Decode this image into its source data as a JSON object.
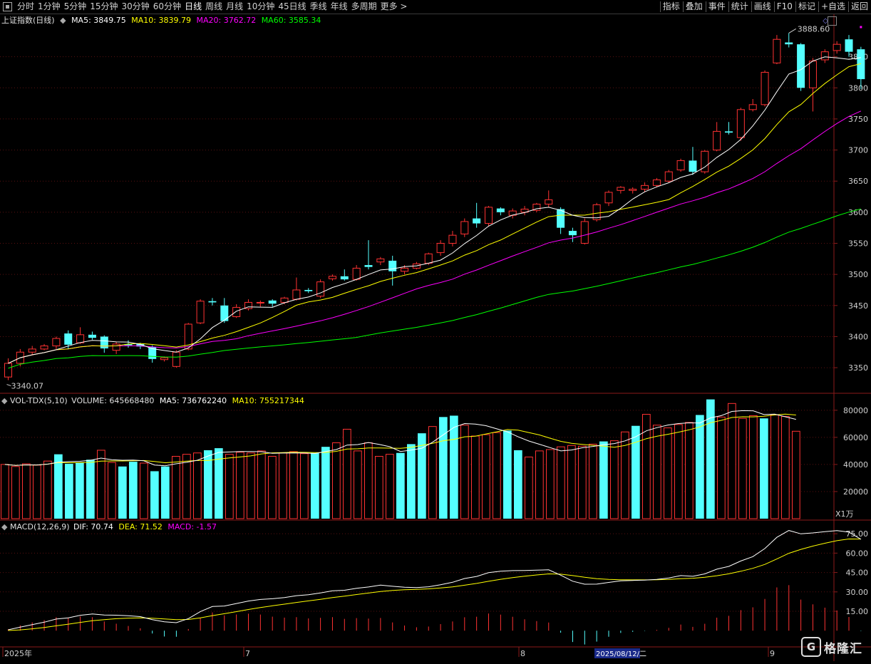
{
  "toolbar": {
    "left_icon": "stop-icon",
    "periods": [
      "分时",
      "1分钟",
      "5分钟",
      "15分钟",
      "30分钟",
      "60分钟",
      "日线",
      "周线",
      "月线",
      "10分钟",
      "45日线",
      "季线",
      "年线",
      "多周期",
      "更多 >"
    ],
    "active_period": "日线",
    "right_tools": [
      "指标",
      "叠加",
      "事件",
      "统计",
      "画线",
      "F10",
      "标记",
      "+自选",
      "返回"
    ]
  },
  "price_panel": {
    "title": "上证指数(日线)",
    "ma5_label": "MA5: 3849.75",
    "ma10_label": "MA10: 3839.79",
    "ma20_label": "MA20: 3762.72",
    "ma60_label": "MA60: 3585.34",
    "high_label": "3888.60",
    "low_label": "3340.07",
    "colors": {
      "up": "#ff3232",
      "down": "#54ffff",
      "ma5": "#ffffff",
      "ma10": "#ffff00",
      "ma20": "#ff00ff",
      "ma60": "#00ff00"
    }
  },
  "vol_panel": {
    "title": "VOL-TDX(5,10)",
    "volume_label": "VOLUME: 645668480",
    "ma5_label": "MA5: 736762240",
    "ma10_label": "MA10: 755217344",
    "unit": "X1万"
  },
  "macd_panel": {
    "title": "MACD(12,26,9)",
    "dif_label": "DIF: 70.74",
    "dea_label": "DEA: 71.52",
    "macd_label": "MACD: -1.57"
  },
  "time_axis": {
    "labels": [
      "2025年",
      "7",
      "8",
      "9"
    ],
    "cursor_date": "2025/08/12/二"
  },
  "watermark": {
    "logo": "G",
    "text": "格隆汇"
  },
  "chart_data": [
    {
      "type": "candlestick",
      "title": "上证指数(日线)",
      "ylim": [
        3310,
        3900
      ],
      "yticks": [
        3350,
        3400,
        3450,
        3500,
        3550,
        3600,
        3650,
        3700,
        3750,
        3800,
        3850
      ],
      "candles": [
        [
          3335,
          3357,
          3330,
          3365
        ],
        [
          3357,
          3375,
          3352,
          3380
        ],
        [
          3375,
          3380,
          3370,
          3385
        ],
        [
          3380,
          3385,
          3378,
          3388
        ],
        [
          3385,
          3397,
          3380,
          3400
        ],
        [
          3405,
          3387,
          3380,
          3410
        ],
        [
          3390,
          3403,
          3388,
          3415
        ],
        [
          3403,
          3398,
          3395,
          3408
        ],
        [
          3400,
          3381,
          3374,
          3402
        ],
        [
          3378,
          3388,
          3372,
          3392
        ],
        [
          3388,
          3386,
          3382,
          3394
        ],
        [
          3388,
          3384,
          3380,
          3390
        ],
        [
          3383,
          3364,
          3358,
          3386
        ],
        [
          3363,
          3366,
          3360,
          3368
        ],
        [
          3352,
          3375,
          3350,
          3378
        ],
        [
          3380,
          3420,
          3378,
          3422
        ],
        [
          3422,
          3457,
          3420,
          3460
        ],
        [
          3457,
          3455,
          3450,
          3462
        ],
        [
          3450,
          3425,
          3422,
          3462
        ],
        [
          3432,
          3447,
          3430,
          3452
        ],
        [
          3445,
          3455,
          3442,
          3460
        ],
        [
          3455,
          3455,
          3448,
          3458
        ],
        [
          3458,
          3453,
          3448,
          3460
        ],
        [
          3455,
          3462,
          3452,
          3464
        ],
        [
          3460,
          3475,
          3458,
          3495
        ],
        [
          3475,
          3473,
          3470,
          3478
        ],
        [
          3465,
          3488,
          3462,
          3492
        ],
        [
          3493,
          3497,
          3490,
          3500
        ],
        [
          3497,
          3492,
          3490,
          3508
        ],
        [
          3492,
          3510,
          3490,
          3515
        ],
        [
          3515,
          3512,
          3508,
          3555
        ],
        [
          3520,
          3525,
          3515,
          3528
        ],
        [
          3522,
          3505,
          3482,
          3530
        ],
        [
          3505,
          3510,
          3500,
          3515
        ],
        [
          3510,
          3517,
          3508,
          3520
        ],
        [
          3518,
          3533,
          3515,
          3535
        ],
        [
          3535,
          3550,
          3530,
          3555
        ],
        [
          3550,
          3563,
          3545,
          3570
        ],
        [
          3565,
          3585,
          3560,
          3590
        ],
        [
          3590,
          3582,
          3575,
          3615
        ],
        [
          3582,
          3608,
          3578,
          3610
        ],
        [
          3606,
          3600,
          3595,
          3608
        ],
        [
          3595,
          3602,
          3590,
          3606
        ],
        [
          3600,
          3605,
          3595,
          3610
        ],
        [
          3603,
          3613,
          3600,
          3615
        ],
        [
          3613,
          3620,
          3608,
          3635
        ],
        [
          3605,
          3575,
          3565,
          3608
        ],
        [
          3570,
          3563,
          3552,
          3575
        ],
        [
          3550,
          3585,
          3548,
          3590
        ],
        [
          3588,
          3612,
          3585,
          3615
        ],
        [
          3615,
          3632,
          3610,
          3635
        ],
        [
          3635,
          3640,
          3630,
          3642
        ],
        [
          3635,
          3637,
          3630,
          3640
        ],
        [
          3637,
          3643,
          3632,
          3648
        ],
        [
          3643,
          3652,
          3640,
          3655
        ],
        [
          3650,
          3665,
          3648,
          3668
        ],
        [
          3668,
          3683,
          3665,
          3686
        ],
        [
          3683,
          3665,
          3660,
          3705
        ],
        [
          3665,
          3698,
          3662,
          3700
        ],
        [
          3700,
          3730,
          3698,
          3745
        ],
        [
          3730,
          3728,
          3725,
          3745
        ],
        [
          3720,
          3765,
          3715,
          3768
        ],
        [
          3765,
          3773,
          3762,
          3782
        ],
        [
          3773,
          3825,
          3770,
          3828
        ],
        [
          3840,
          3878,
          3838,
          3885
        ],
        [
          3873,
          3870,
          3865,
          3888
        ],
        [
          3870,
          3800,
          3795,
          3872
        ],
        [
          3800,
          3843,
          3762,
          3848
        ],
        [
          3845,
          3858,
          3840,
          3862
        ],
        [
          3860,
          3870,
          3855,
          3875
        ],
        [
          3878,
          3858,
          3850,
          3885
        ],
        [
          3862,
          3814,
          3798,
          3866
        ]
      ]
    },
    {
      "type": "bar",
      "title": "VOL-TDX(5,10)",
      "unit": "X1万",
      "ylim": [
        0,
        92000
      ],
      "yticks": [
        20000,
        40000,
        60000,
        80000
      ],
      "up_down": "uuuuudddduuddudduuudduuuuuuuudduuuuuudddudduuuudduuuuuuuduuduuuuudduuuud",
      "values": [
        40000,
        38500,
        40500,
        39500,
        42500,
        47500,
        40500,
        41500,
        43500,
        50500,
        41500,
        38500,
        42000,
        41000,
        35000,
        38500,
        46000,
        47500,
        48500,
        50500,
        52000,
        47500,
        49000,
        48500,
        50000,
        46000,
        48500,
        49500,
        48000,
        48500,
        53000,
        56000,
        66000,
        50000,
        56000,
        46000,
        47500,
        48500,
        55000,
        63000,
        68000,
        75000,
        76000,
        69000,
        61000,
        62000,
        63500,
        65000,
        50500,
        45500,
        50000,
        51000,
        53000,
        54000,
        53500,
        55000,
        57000,
        57500,
        64000,
        68500,
        77000,
        69000,
        67000,
        69500,
        71000,
        76500,
        88000,
        75000,
        85000,
        74000,
        76000,
        74000,
        76500,
        75500,
        64500
      ],
      "series": [
        {
          "name": "MA5"
        },
        {
          "name": "MA10"
        }
      ]
    },
    {
      "type": "bar+line",
      "title": "MACD(12,26,9)",
      "ylim": [
        -12,
        85
      ],
      "yticks": [
        15.0,
        30.0,
        45.0,
        60.0,
        75.0
      ],
      "series": [
        {
          "name": "DIF"
        },
        {
          "name": "DEA"
        },
        {
          "name": "MACD"
        }
      ]
    }
  ]
}
